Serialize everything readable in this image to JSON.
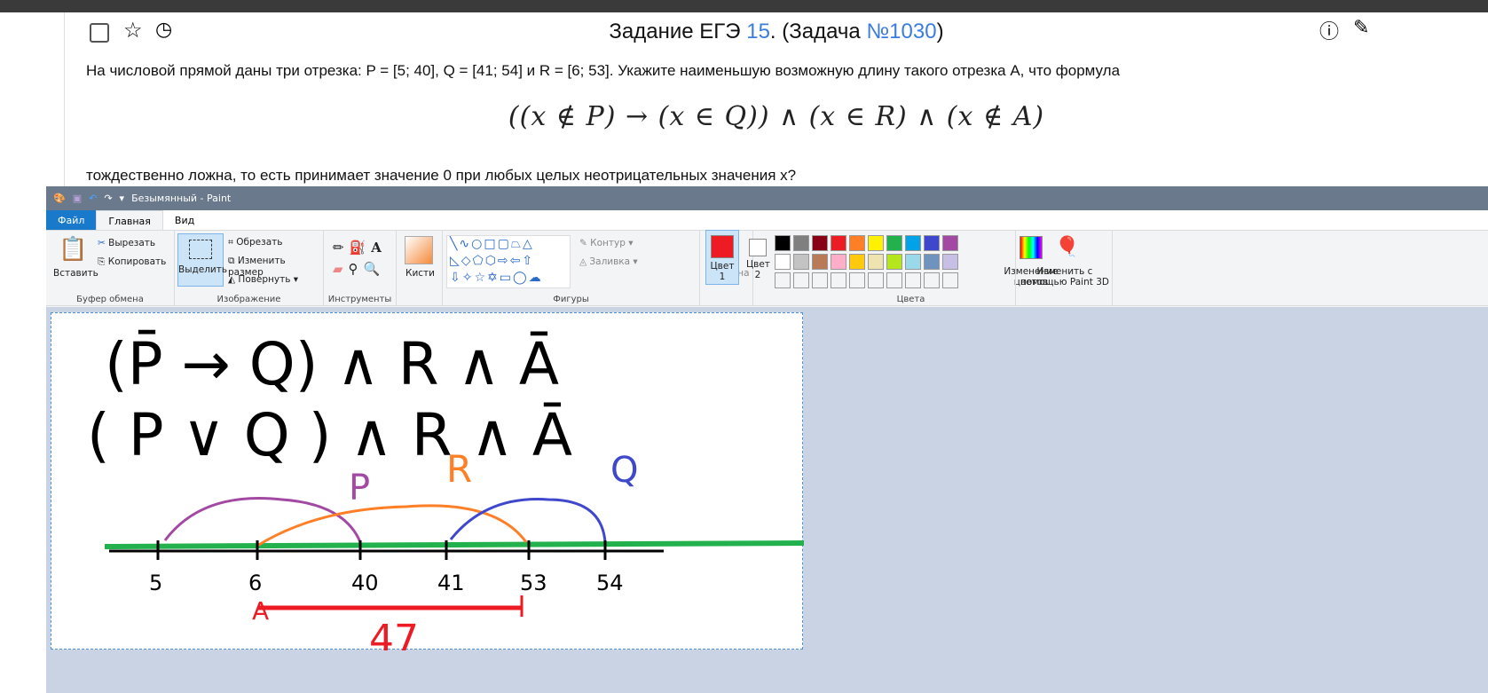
{
  "header": {
    "title_prefix": "Задание ЕГЭ ",
    "task_num": "15",
    "title_mid": ". (Задача ",
    "task_id": "№1030",
    "title_suffix": ")"
  },
  "problem": {
    "line1": "На числовой прямой даны три отрезка: P = [5; 40], Q = [41; 54] и R = [6; 53]. Укажите наименьшую возможную длину такого отрезка A, что формула",
    "formula": "((x ∉ P) → (x ∈ Q)) ∧ (x ∈ R) ∧ (x ∉ A)",
    "line2": "тождественно ложна, то есть принимает значение 0 при любых целых неотрицательных значения x?"
  },
  "paint": {
    "window_title": "Безымянный - Paint",
    "tabs": [
      "Файл",
      "Главная",
      "Вид"
    ],
    "clipboard": {
      "paste": "Вставить",
      "cut": "Вырезать",
      "copy": "Копировать",
      "label": "Буфер обмена"
    },
    "image": {
      "select": "Выделить",
      "crop": "Обрезать",
      "resize": "Изменить размер",
      "rotate": "Повернуть",
      "label": "Изображение"
    },
    "tools": {
      "label": "Инструменты"
    },
    "brushes": {
      "label": "Кисти"
    },
    "shapes": {
      "label": "Фигуры",
      "outline": "Контур",
      "fill": "Заливка"
    },
    "thickness": "Толщина",
    "color1": "Цвет 1",
    "color2": "Цвет 2",
    "edit_colors": "Изменение цветов",
    "paint3d": "Изменить с помощью Paint 3D",
    "colors_label": "Цвета",
    "active_color": "#ed1c24",
    "palette_row1": [
      "#000000",
      "#7f7f7f",
      "#880015",
      "#ed1c24",
      "#ff7f27",
      "#fff200",
      "#22b14c",
      "#00a2e8",
      "#3f48cc",
      "#a349a4"
    ],
    "palette_row2": [
      "#ffffff",
      "#c3c3c3",
      "#b97a57",
      "#ffaec9",
      "#ffc90e",
      "#efe4b0",
      "#b5e61d",
      "#99d9ea",
      "#7092be",
      "#c8bfe7"
    ]
  },
  "drawing": {
    "line1": "(P̄ → Q) ∧ R ∧ Ā",
    "line2": "( P ∨ Q ) ∧ R ∧ Ā",
    "labels": {
      "P": "P",
      "R": "R",
      "Q": "Q"
    },
    "ticks": [
      "5",
      "6",
      "40",
      "41",
      "53",
      "54"
    ],
    "answer_label": "A",
    "answer": "47"
  }
}
